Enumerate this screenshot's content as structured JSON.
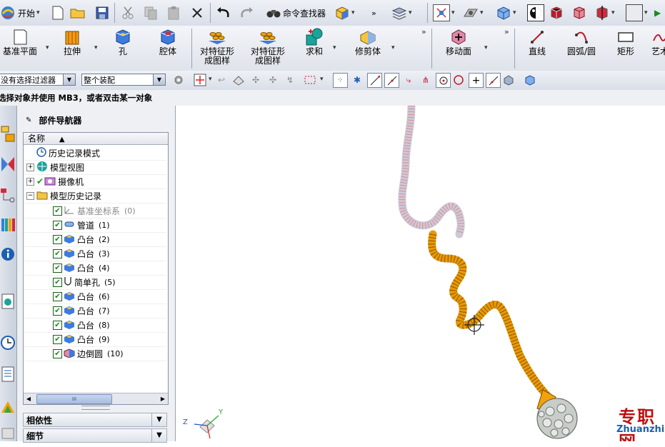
{
  "toolbar_top": {
    "start_label": "开始",
    "command_finder_label": "命令查找器"
  },
  "feature_toolbar": {
    "items": [
      {
        "label": "基准平面"
      },
      {
        "label": "拉伸"
      },
      {
        "label": "孔"
      },
      {
        "label": "腔体"
      },
      {
        "label": "对特征形\n成图样"
      },
      {
        "label": "对特征形\n成图样"
      },
      {
        "label": "求和"
      },
      {
        "label": "修剪体"
      },
      {
        "label": "移动面"
      },
      {
        "label": "直线"
      },
      {
        "label": "圆弧/圆"
      },
      {
        "label": "矩形"
      },
      {
        "label": "艺术"
      }
    ]
  },
  "selection_bar": {
    "filter_value": "没有选择过滤器",
    "scope_value": "整个装配"
  },
  "status": {
    "prompt": "选择对象并使用 MB3，或者双击某一对象"
  },
  "navigator": {
    "title": "部件导航器",
    "column_header": "名称",
    "sort_indicator": "▲",
    "nodes": [
      {
        "label": "历史记录模式",
        "num": ""
      },
      {
        "label": "模型视图",
        "num": ""
      },
      {
        "label": "摄像机",
        "num": ""
      },
      {
        "label": "模型历史记录",
        "num": ""
      },
      {
        "label": "基准坐标系",
        "num": "(0)"
      },
      {
        "label": "管道",
        "num": "(1)"
      },
      {
        "label": "凸台",
        "num": "(2)"
      },
      {
        "label": "凸台",
        "num": "(3)"
      },
      {
        "label": "凸台",
        "num": "(4)"
      },
      {
        "label": "简单孔",
        "num": "(5)"
      },
      {
        "label": "凸台",
        "num": "(6)"
      },
      {
        "label": "凸台",
        "num": "(7)"
      },
      {
        "label": "凸台",
        "num": "(8)"
      },
      {
        "label": "凸台",
        "num": "(9)"
      },
      {
        "label": "边倒圆",
        "num": "(10)"
      }
    ],
    "scroll_label": "III",
    "sections": [
      "相依性",
      "细节"
    ]
  },
  "viewport": {
    "triad_z": "Z",
    "triad_y": "Y"
  },
  "watermark": {
    "cn": "专职网",
    "en": "Zhuanzhi.Net"
  },
  "colors": {
    "accent_orange": "#f0a20a",
    "pipe_gray": "#b9b0c6",
    "watermark_red": "#bb1111",
    "watermark_blue": "#1b5fae"
  }
}
